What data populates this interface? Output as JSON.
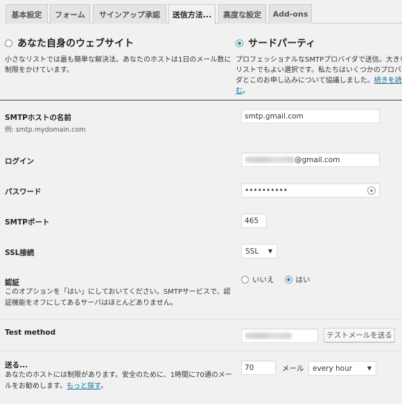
{
  "tabs": [
    {
      "label": "基本設定"
    },
    {
      "label": "フォーム"
    },
    {
      "label": "サインアップ承認"
    },
    {
      "label": "送信方法..."
    },
    {
      "label": "高度な設定"
    },
    {
      "label": "Add-ons"
    }
  ],
  "active_tab": "送信方法...",
  "options": {
    "own": {
      "title": "あなた自身のウェブサイト",
      "desc": "小さなリストでは最も簡単な解決法。あなたのホストは1日のメール数に制限をかけています。",
      "selected": false
    },
    "third": {
      "title": "サードパーティ",
      "desc": "プロフェッショナルなSMTPプロバイダで送信。大きなリストでもよい選択です。私たちはいくつかのプロバイダとこのお申し込みについて協議しました。",
      "link": "続きを読む",
      "link_suffix": "。",
      "selected": true
    }
  },
  "fields": {
    "host": {
      "label": "SMTPホストの名前",
      "hint": "例: smtp.mydomain.com",
      "value": "smtp.gmail.com"
    },
    "login": {
      "label": "ログイン",
      "value_suffix": "@gmail.com"
    },
    "password": {
      "label": "パスワード",
      "value": "••••••••••"
    },
    "port": {
      "label": "SMTPポート",
      "value": "465"
    },
    "ssl": {
      "label": "SSL接続",
      "value": "SSL"
    },
    "auth": {
      "label": "認証",
      "desc": "このオプションを「はい」にしておいてください。SMTPサービスで、認証機能をオフにしてあるサーバはほとんどありません。",
      "no": "いいえ",
      "yes": "はい",
      "selected": "はい"
    },
    "test": {
      "label": "Test method",
      "button": "テストメールを送る"
    },
    "send": {
      "label": "送る...",
      "desc": "あなたのホストには制限があります。安全のために、1時間に70通のメールをお勧めします。",
      "link": "もっと探す",
      "link_suffix": "。",
      "count": "70",
      "unit": "メール",
      "frequency": "every hour"
    }
  },
  "colors": {
    "accent": "#1e8cbe",
    "link": "#0073aa",
    "background": "#f1f1f1"
  }
}
